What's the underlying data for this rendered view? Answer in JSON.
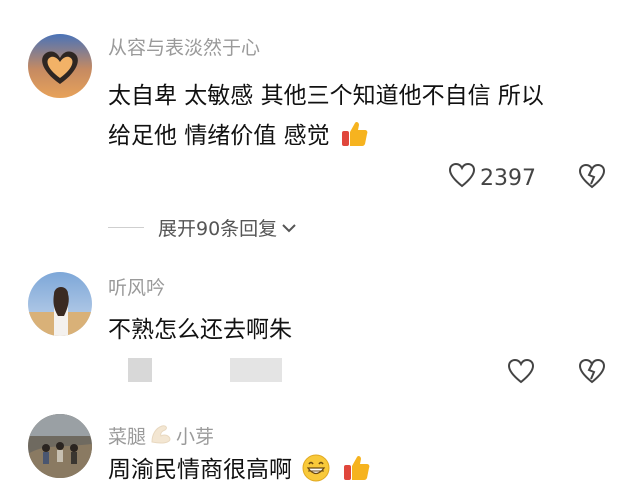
{
  "comments": [
    {
      "username": "从容与表淡然于心",
      "text_line1": "太自卑 太敏感 其他三个知道他不自信 所以",
      "text_line2": "给足他 情绪价值 感觉",
      "likes": "2397",
      "expand": "展开90条回复"
    },
    {
      "username": "听风吟",
      "text_line1": "不熟怎么还去啊朱"
    },
    {
      "username_part1": "菜腿",
      "username_part2": "小芽",
      "text_line1": "周渝民情商很高啊"
    }
  ],
  "icons": [
    "heart-icon",
    "broken-heart-icon",
    "chevron-down-icon",
    "thumbs-up-icon",
    "grin-emoji-icon"
  ],
  "colors": {
    "username": "#9a9a9a",
    "text": "#111111",
    "icon": "#444444"
  }
}
